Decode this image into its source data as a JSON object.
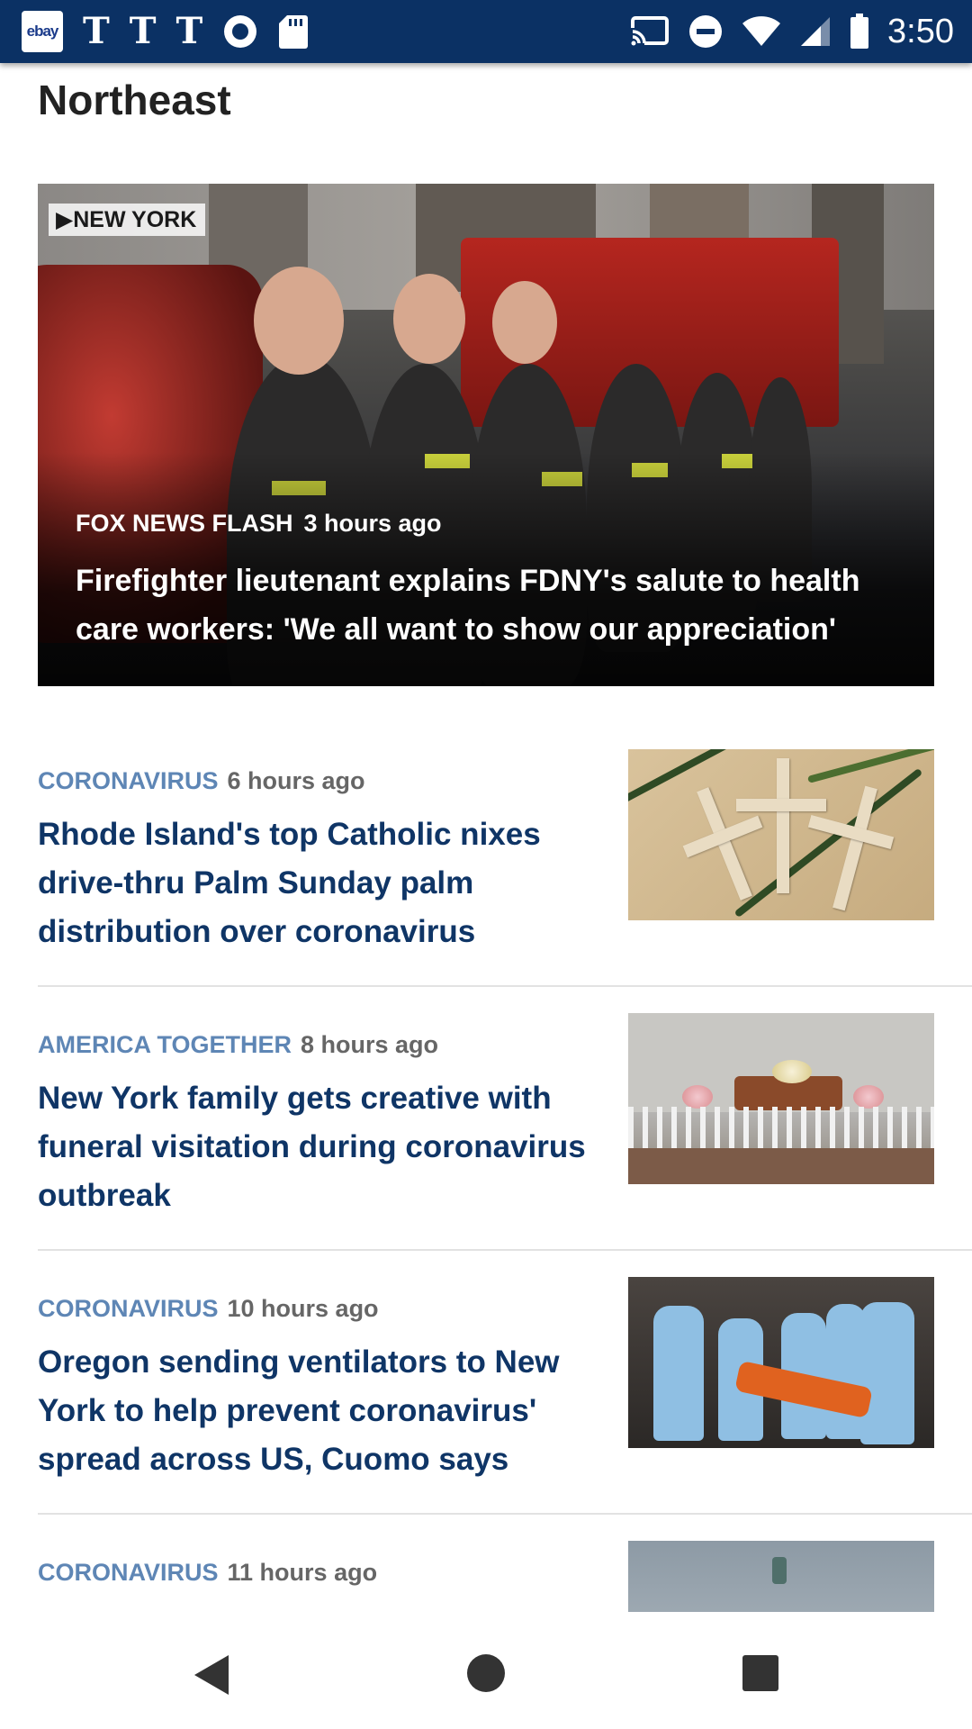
{
  "status_bar": {
    "time": "3:50",
    "left_icons": [
      "ebay-icon",
      "nyt-icon",
      "nyt-icon",
      "nyt-icon",
      "record-icon",
      "sd-card-icon"
    ],
    "ebay_label": "ebay",
    "nyt_glyph": "T",
    "right_icons": [
      "cast-icon",
      "dnd-icon",
      "wifi-icon",
      "signal-icon",
      "battery-icon"
    ]
  },
  "section_title": "Northeast",
  "hero": {
    "location_tag": "▶NEW YORK",
    "source": "FOX NEWS FLASH",
    "time": "3 hours ago",
    "headline": "Firefighter lieutenant explains FDNY's salute to health care workers: 'We all want to show our appreciation'"
  },
  "articles": [
    {
      "category": "CORONAVIRUS",
      "time": "6 hours ago",
      "title": "Rhode Island's top Catholic nixes drive-thru Palm Sunday palm distribution over coronavirus"
    },
    {
      "category": "AMERICA TOGETHER",
      "time": "8 hours ago",
      "title": "New York family gets creative with funeral visitation during coronavirus outbreak"
    },
    {
      "category": "CORONAVIRUS",
      "time": "10 hours ago",
      "title": "Oregon sending ventilators to New York to help prevent coronavirus' spread across US, Cuomo says"
    },
    {
      "category": "CORONAVIRUS",
      "time": "11 hours ago",
      "title": ""
    }
  ],
  "colors": {
    "status_bar": "#0b3164",
    "category": "#5e86b5",
    "title": "#0f3566"
  }
}
